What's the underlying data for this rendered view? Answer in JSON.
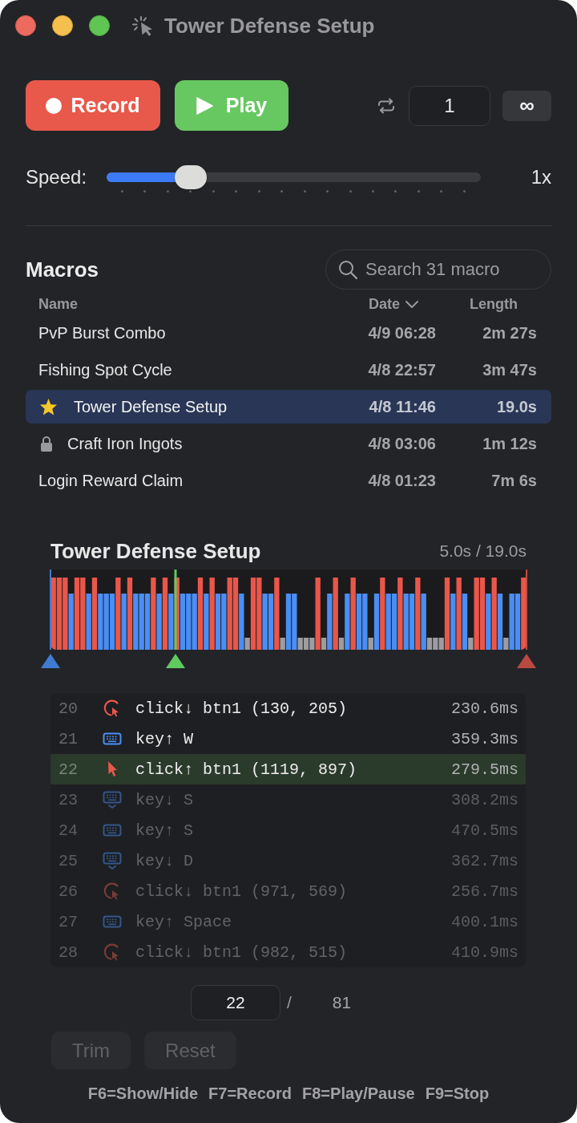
{
  "window": {
    "title": "Tower Defense Setup"
  },
  "controls": {
    "record": {
      "label": "Record"
    },
    "play": {
      "label": "Play"
    },
    "repeat_count": {
      "value": "1"
    },
    "infinite_button": {
      "label": "∞"
    }
  },
  "speed": {
    "label": "Speed:",
    "level": 0.225,
    "reading": "1x"
  },
  "macros": {
    "title": "Macros",
    "search": {
      "placeholder": "Search 31 macro"
    },
    "columns": [
      {
        "label": "Name",
        "sorted": false
      },
      {
        "label": "Date",
        "sorted": true
      },
      {
        "label": "Length",
        "sorted": false
      }
    ],
    "rows": [
      {
        "name": "PvP Burst Combo",
        "date": "4/9 06:28",
        "length": "2m 27s",
        "selected": false,
        "favorite": false,
        "locked": false
      },
      {
        "name": "Fishing Spot Cycle",
        "date": "4/8 22:57",
        "length": "3m 47s",
        "selected": false,
        "favorite": false,
        "locked": false
      },
      {
        "name": "Tower Defense Setup",
        "date": "4/8 11:46",
        "length": "19.0s",
        "selected": true,
        "favorite": true,
        "locked": false
      },
      {
        "name": "Craft Iron Ingots",
        "date": "4/8 03:06",
        "length": "1m 12s",
        "selected": false,
        "favorite": false,
        "locked": true
      },
      {
        "name": "Login Reward Claim",
        "date": "4/8 01:23",
        "length": "7m 6s",
        "selected": false,
        "favorite": false,
        "locked": false
      }
    ]
  },
  "timeline": {
    "title": "Tower Defense Setup",
    "time": "5.0s / 19.0s",
    "trim_start": {
      "level": 0
    },
    "playhead": {
      "level": 0.263
    },
    "trim_end": {
      "level": 1
    }
  },
  "events": [
    {
      "index": "20",
      "kind": "click_down",
      "action": "click↓ btn1 (130, 205)",
      "duration": "230.6ms",
      "selected": false,
      "dimmed": false
    },
    {
      "index": "21",
      "kind": "key_up",
      "action": "key↑ W",
      "duration": "359.3ms",
      "selected": false,
      "dimmed": false
    },
    {
      "index": "22",
      "kind": "click_up",
      "action": "click↑ btn1 (1119, 897)",
      "duration": "279.5ms",
      "selected": true,
      "dimmed": false
    },
    {
      "index": "23",
      "kind": "key_down",
      "action": "key↓ S",
      "duration": "308.2ms",
      "selected": false,
      "dimmed": true
    },
    {
      "index": "24",
      "kind": "key_up",
      "action": "key↑ S",
      "duration": "470.5ms",
      "selected": false,
      "dimmed": true
    },
    {
      "index": "25",
      "kind": "key_down",
      "action": "key↓ D",
      "duration": "362.7ms",
      "selected": false,
      "dimmed": true
    },
    {
      "index": "26",
      "kind": "click_down",
      "action": "click↓ btn1 (971, 569)",
      "duration": "256.7ms",
      "selected": false,
      "dimmed": true
    },
    {
      "index": "27",
      "kind": "key_up",
      "action": "key↑ Space",
      "duration": "400.1ms",
      "selected": false,
      "dimmed": true
    },
    {
      "index": "28",
      "kind": "click_down",
      "action": "click↓ btn1 (982, 515)",
      "duration": "410.9ms",
      "selected": false,
      "dimmed": true
    }
  ],
  "position": {
    "current": "22",
    "separator": "/",
    "total": "81"
  },
  "buttons": [
    {
      "label": "Trim",
      "disabled": true
    },
    {
      "label": "Reset",
      "disabled": true
    }
  ],
  "shortcuts": [
    "F6=Show/Hide",
    "F7=Record",
    "F8=Play/Pause",
    "F9=Stop"
  ]
}
